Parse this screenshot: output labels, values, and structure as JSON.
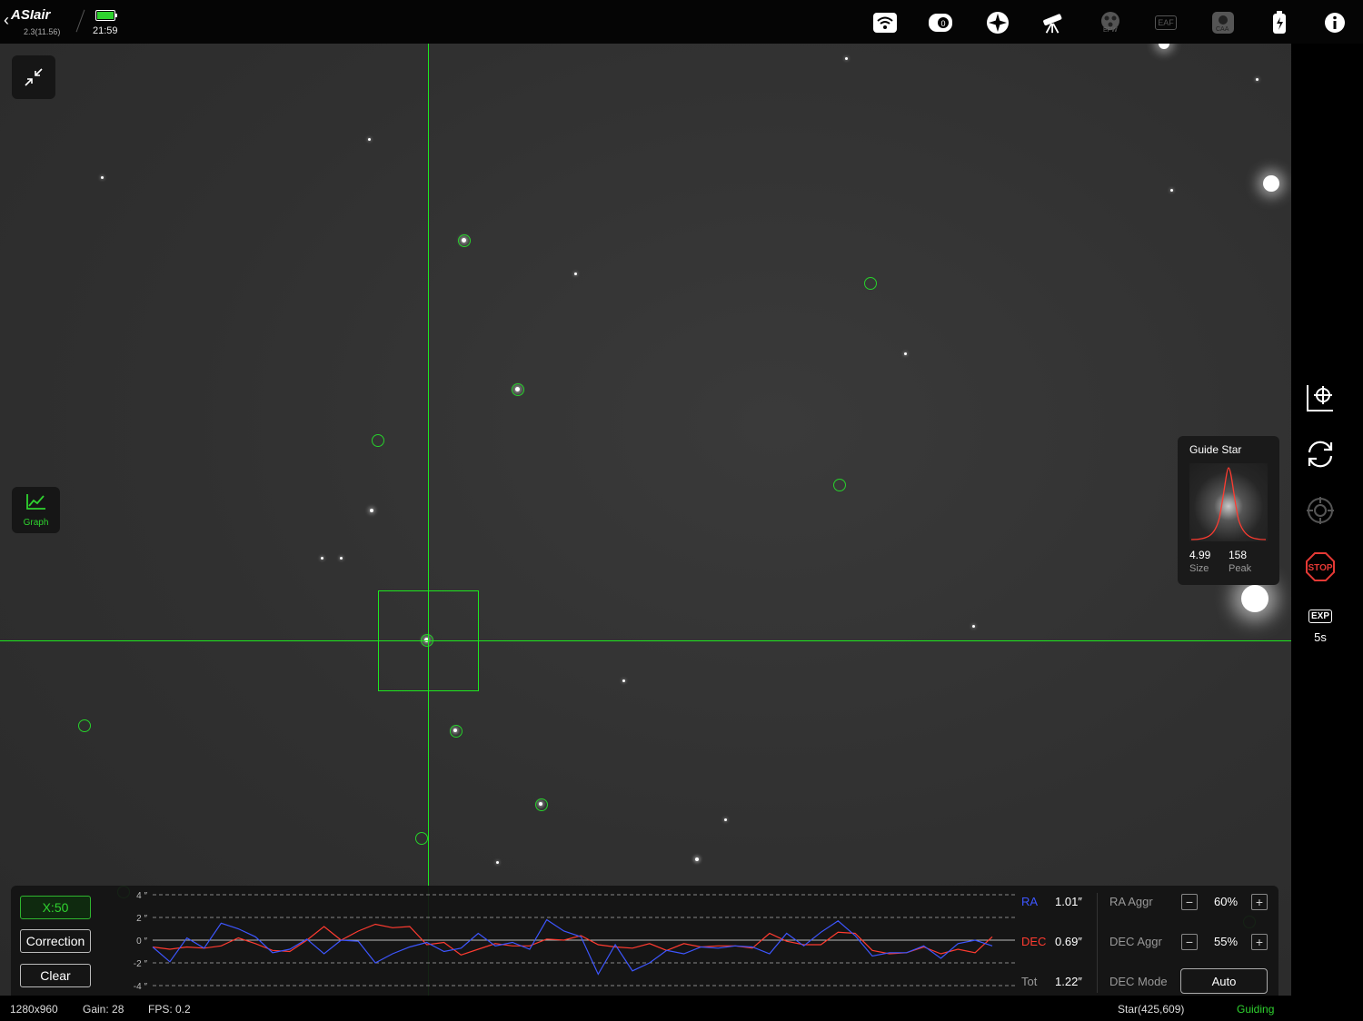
{
  "app": {
    "logo": "ASIair",
    "version": "2.3(11.56)",
    "time": "21:59"
  },
  "topbar_icons": [
    "wifi-icon",
    "camera-icon",
    "focus-target-icon",
    "telescope-icon",
    "efw-icon",
    "eaf-icon",
    "caa-icon",
    "power-icon",
    "info-icon"
  ],
  "topbar_labels": {
    "efw": "EFW",
    "eaf": "EAF",
    "caa": "CAA"
  },
  "graph_button_label": "Graph",
  "guide_star": {
    "title": "Guide Star",
    "size_value": "4.99",
    "size_label": "Size",
    "peak_value": "158",
    "peak_label": "Peak"
  },
  "right_sidebar": {
    "stop_label": "STOP",
    "exp_label": "EXP",
    "exp_value": "5s"
  },
  "graph_panel": {
    "x_scale_button": "X:50",
    "correction_button": "Correction",
    "clear_button": "Clear",
    "y_ticks": [
      "4 ″",
      "2 ″",
      "0 ″",
      "-2 ″",
      "-4 ″"
    ],
    "ra_label": "RA",
    "ra_value": "1.01″",
    "dec_label": "DEC",
    "dec_value": "0.69″",
    "tot_label": "Tot",
    "tot_value": "1.22″",
    "ra_aggr_label": "RA Aggr",
    "ra_aggr_value": "60%",
    "dec_aggr_label": "DEC Aggr",
    "dec_aggr_value": "55%",
    "dec_mode_label": "DEC Mode",
    "dec_mode_value": "Auto",
    "minus": "−",
    "plus": "+"
  },
  "chart_data": {
    "type": "line",
    "ylim": [
      -4,
      4
    ],
    "series": [
      {
        "name": "RA",
        "color": "#3d56ff",
        "values": [
          -0.6,
          -1.9,
          0.2,
          -0.7,
          1.5,
          1.0,
          0.3,
          -1.1,
          -0.8,
          0.1,
          -1.2,
          0.0,
          -0.1,
          -2.0,
          -1.2,
          -0.6,
          -0.2,
          -1.0,
          -0.7,
          0.6,
          -0.5,
          -0.2,
          -0.8,
          1.8,
          0.8,
          0.3,
          -3.0,
          -0.4,
          -2.7,
          -2.0,
          -0.9,
          -1.2,
          -0.6,
          -0.7,
          -0.5,
          -0.6,
          -1.2,
          0.6,
          -0.5,
          0.7,
          1.7,
          0.4,
          -1.4,
          -1.1,
          -1.1,
          -0.5,
          -1.6,
          -0.3,
          0.0,
          -0.5
        ]
      },
      {
        "name": "DEC",
        "color": "#ff3b30",
        "values": [
          -0.6,
          -0.8,
          -0.6,
          -0.7,
          -0.5,
          0.2,
          -0.3,
          -0.9,
          -1.0,
          0.0,
          1.2,
          0.0,
          0.8,
          1.4,
          1.1,
          1.2,
          -0.4,
          -0.2,
          -1.3,
          -0.8,
          -0.3,
          -0.5,
          -0.5,
          0.1,
          0.0,
          0.4,
          -0.4,
          -0.6,
          -0.7,
          -0.3,
          -0.9,
          -0.3,
          -0.6,
          -0.5,
          -0.5,
          -0.7,
          0.6,
          -0.1,
          -0.4,
          -0.4,
          0.7,
          0.6,
          -0.9,
          -1.2,
          -1.1,
          -0.6,
          -1.2,
          -0.8,
          -1.1,
          0.3
        ]
      }
    ]
  },
  "status_bar": {
    "resolution": "1280x960",
    "gain": "Gain: 28",
    "fps": "FPS: 0.2",
    "star": "Star(425,609)",
    "state": "Guiding"
  },
  "colors": {
    "accent": "#2fd32f",
    "crosshair": "#1ee81e",
    "stop": "#e53935"
  }
}
